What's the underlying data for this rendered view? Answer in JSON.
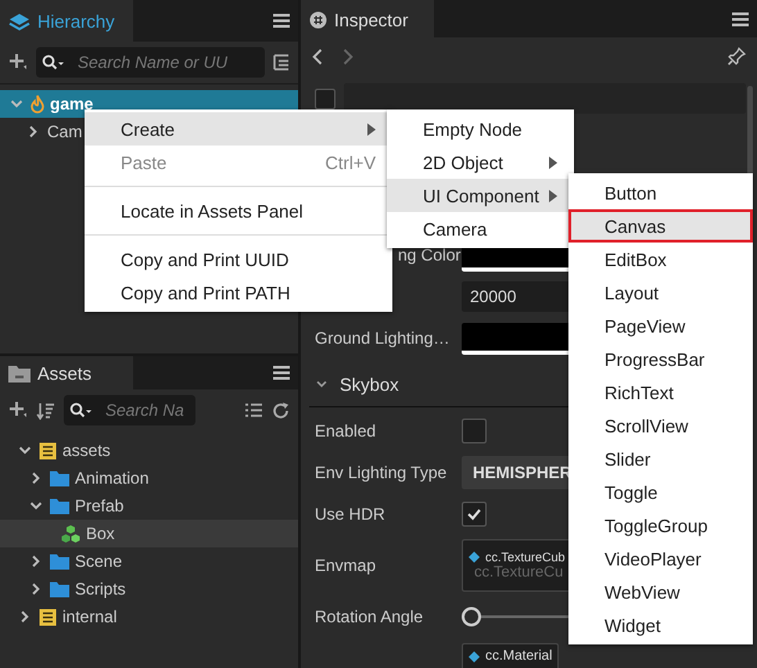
{
  "hierarchy": {
    "tab": "Hierarchy",
    "search": {
      "placeholder": "Search Name or UU"
    },
    "nodes": [
      {
        "name": "game",
        "kind": "scene",
        "expanded": true,
        "selected": true,
        "children": [
          {
            "name": "Cam",
            "expanded": false,
            "selected": false
          }
        ]
      }
    ]
  },
  "assets": {
    "tab": "Assets",
    "search": {
      "placeholder": "Search Na"
    },
    "nodes": [
      {
        "name": "assets",
        "kind": "db",
        "expanded": true,
        "selected": false,
        "children": [
          {
            "name": "Animation",
            "kind": "folder",
            "expanded": false,
            "selected": false
          },
          {
            "name": "Prefab",
            "kind": "folder",
            "expanded": true,
            "selected": false,
            "children": [
              {
                "name": "Box",
                "kind": "prefab",
                "selected": true
              }
            ]
          },
          {
            "name": "Scene",
            "kind": "folder",
            "expanded": false,
            "selected": false
          },
          {
            "name": "Scripts",
            "kind": "folder",
            "expanded": false,
            "selected": false
          }
        ]
      },
      {
        "name": "internal",
        "kind": "db",
        "expanded": false,
        "selected": false
      }
    ]
  },
  "inspector": {
    "tab": "Inspector",
    "node_active": false,
    "rows": [
      {
        "kind": "color",
        "label": "ng Color",
        "label_cut": true
      },
      {
        "kind": "number",
        "value": "20000"
      },
      {
        "kind": "color",
        "label": "Ground Lighting…",
        "label_cut": false
      },
      {
        "kind": "section",
        "label": "Skybox",
        "expanded": true
      },
      {
        "kind": "checkbox",
        "label": "Enabled",
        "checked": false
      },
      {
        "kind": "select",
        "label": "Env Lighting Type",
        "value": "HEMISPHER"
      },
      {
        "kind": "checkbox",
        "label": "Use HDR",
        "checked": true
      },
      {
        "kind": "asset",
        "label": "Envmap",
        "type": "cc.TextureCub",
        "placeholder": "cc.TextureCu"
      },
      {
        "kind": "slider",
        "label": "Rotation Angle",
        "level": 0
      },
      {
        "kind": "tag",
        "type": "cc.Material"
      }
    ]
  },
  "context_menu": {
    "items": [
      {
        "kind": "item",
        "label": "Create",
        "submenu": true,
        "selected": true,
        "disabled": false
      },
      {
        "kind": "item",
        "label": "Paste",
        "shortcut": "Ctrl+V",
        "submenu": false,
        "selected": false,
        "disabled": true
      },
      {
        "kind": "separator"
      },
      {
        "kind": "item",
        "label": "Locate in Assets Panel",
        "submenu": false,
        "selected": false,
        "disabled": false
      },
      {
        "kind": "separator"
      },
      {
        "kind": "item",
        "label": "Copy and Print UUID",
        "submenu": false,
        "selected": false,
        "disabled": false
      },
      {
        "kind": "item",
        "label": "Copy and Print PATH",
        "submenu": false,
        "selected": false,
        "disabled": false
      }
    ]
  },
  "create_menu": {
    "items": [
      {
        "label": "Empty Node",
        "submenu": false,
        "selected": false
      },
      {
        "label": "2D Object",
        "submenu": true,
        "selected": false
      },
      {
        "label": "UI Component",
        "submenu": true,
        "selected": true
      },
      {
        "label": "Camera",
        "submenu": false,
        "selected": false
      }
    ]
  },
  "ui_menu": {
    "items": [
      {
        "label": "Button",
        "selected": false,
        "outlined": false
      },
      {
        "label": "Canvas",
        "selected": true,
        "outlined": true
      },
      {
        "label": "EditBox",
        "selected": false,
        "outlined": false
      },
      {
        "label": "Layout",
        "selected": false,
        "outlined": false
      },
      {
        "label": "PageView",
        "selected": false,
        "outlined": false
      },
      {
        "label": "ProgressBar",
        "selected": false,
        "outlined": false
      },
      {
        "label": "RichText",
        "selected": false,
        "outlined": false
      },
      {
        "label": "ScrollView",
        "selected": false,
        "outlined": false
      },
      {
        "label": "Slider",
        "selected": false,
        "outlined": false
      },
      {
        "label": "Toggle",
        "selected": false,
        "outlined": false
      },
      {
        "label": "ToggleGroup",
        "selected": false,
        "outlined": false
      },
      {
        "label": "VideoPlayer",
        "selected": false,
        "outlined": false
      },
      {
        "label": "WebView",
        "selected": false,
        "outlined": false
      },
      {
        "label": "Widget",
        "selected": false,
        "outlined": false
      }
    ]
  }
}
